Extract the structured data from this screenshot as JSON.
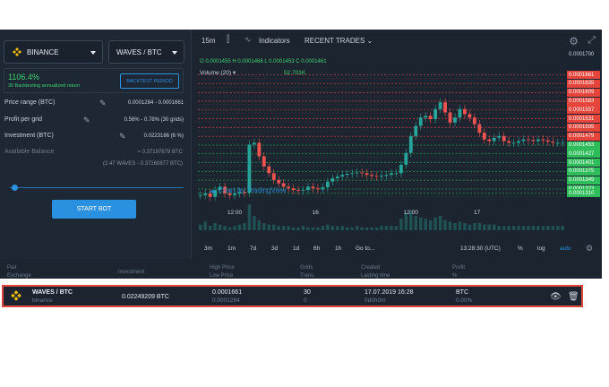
{
  "left_panel": {
    "exchange": "BINANCE",
    "pair": "WAVES / BTC",
    "return_value": "1106.4%",
    "return_label": "30 Backtesting annualized return",
    "backtest_button": "BACKTEST PERIOD",
    "price_range_label": "Price range (BTC)",
    "price_range_value": "0.0001284 - 0.0001661",
    "profit_label": "Profit per grid",
    "profit_value": "0.56% - 0.78% (30 grids)",
    "investment_label": "Investment (BTC)",
    "investment_value": "0.0223186 (6 %)",
    "available_label": "Available Balance",
    "available_btc": "≈ 0.37197679 BTC",
    "available_waves": "(2.47 WAVES - 0.37160877 BTC)",
    "investment_slider_level_percent": 6,
    "start_button": "START BOT"
  },
  "chart_toolbar": {
    "interval": "15m",
    "indicators": "Indicators",
    "recent_trades": "RECENT TRADES"
  },
  "chart_header": {
    "ohlc": "O 0.0001455  H 0.0001468  L 0.0001453  C 0.0001461",
    "volume_label": "Volume (20)",
    "volume_value": "52.701K"
  },
  "chart_data": {
    "type": "candlestick",
    "title": "",
    "x_tick_labels": [
      "12:00",
      "16",
      "12:00",
      "17"
    ],
    "y_top_label": "0.0001700",
    "y_tag_values": [
      "0.0001661",
      "0.0001635",
      "0.0001609",
      "0.0001583",
      "0.0001557",
      "0.0001531",
      "0.0001505",
      "0.0001479",
      "0.0001453",
      "0.0001427",
      "0.0001401",
      "0.0001375",
      "0.0001349",
      "0.0001323",
      "0.0001310"
    ],
    "grid_levels_red": 13,
    "grid_levels_green": 9,
    "ylim": [
      0.000127,
      0.00017
    ],
    "close_series": [
      0.0001305,
      0.000131,
      0.00013,
      0.000132,
      0.000133,
      0.000131,
      0.0001305,
      0.000131,
      0.0001315,
      0.0001312,
      0.0001455,
      0.000146,
      0.000142,
      0.000139,
      0.000137,
      0.000135,
      0.000134,
      0.000133,
      0.0001325,
      0.000132,
      0.0001318,
      0.000132,
      0.000133,
      0.0001325,
      0.0001322,
      0.0001328,
      0.0001345,
      0.0001355,
      0.000136,
      0.0001365,
      0.0001368,
      0.000137,
      0.0001372,
      0.000137,
      0.0001365,
      0.0001362,
      0.000136,
      0.0001362,
      0.0001365,
      0.000137,
      0.000137,
      0.0001395,
      0.000143,
      0.000148,
      0.000151,
      0.0001535,
      0.000154,
      0.000153,
      0.000156,
      0.000158,
      0.000155,
      0.000152,
      0.0001535,
      0.000156,
      0.0001545,
      0.0001535,
      0.0001515,
      0.000149,
      0.000147,
      0.0001465,
      0.0001475,
      0.000148,
      0.0001465,
      0.000146,
      0.000146,
      0.0001465,
      0.000147,
      0.0001468,
      0.0001465,
      0.000147,
      0.0001467,
      0.0001463,
      0.000146,
      0.000146,
      0.0001461
    ],
    "volume_series": [
      4,
      6,
      3,
      5,
      4,
      3,
      2,
      3,
      4,
      5,
      18,
      10,
      7,
      5,
      4,
      4,
      3,
      3,
      3,
      2,
      2,
      3,
      2,
      2,
      2,
      3,
      4,
      3,
      3,
      3,
      2,
      2,
      3,
      2,
      2,
      2,
      2,
      3,
      3,
      3,
      3,
      8,
      12,
      14,
      10,
      9,
      8,
      7,
      9,
      10,
      7,
      6,
      5,
      6,
      5,
      4,
      5,
      5,
      4,
      4,
      4,
      3,
      3,
      3,
      3,
      3,
      3,
      3,
      3,
      3,
      3,
      3,
      3,
      3,
      3
    ],
    "colors": {
      "up": "#26a69a",
      "down": "#ef5350",
      "grid_sell": "#ff4d4d",
      "grid_buy": "#2ebd5a"
    }
  },
  "chart_controls": {
    "ranges": [
      "3m",
      "1m",
      "7d",
      "3d",
      "1d",
      "6h",
      "1h",
      "Go to..."
    ],
    "time": "13:28:30 (UTC)",
    "percent": "%",
    "log": "log",
    "auto": "auto",
    "watermark": "Chart by TradingView"
  },
  "table": {
    "headers": {
      "pair": "Pair",
      "exchange": "Exchange",
      "investment": "Investment",
      "high": "High Price",
      "low": "Low Price",
      "grids": "Grids",
      "trans": "Trans.",
      "created": "Created",
      "lasting": "Lasting time",
      "profit": "Profit",
      "profit_unit": "%"
    },
    "row": {
      "pair": "WAVES / BTC",
      "exchange": "binance",
      "investment": "0.02249209 BTC",
      "high": "0.0001661",
      "low": "0.0001284",
      "grids": "30",
      "trans": "0",
      "created": "17.07.2019 16:28",
      "lasting": "0d0h0m",
      "profit_unit": "BTC",
      "profit_pct": "0.00%"
    }
  }
}
